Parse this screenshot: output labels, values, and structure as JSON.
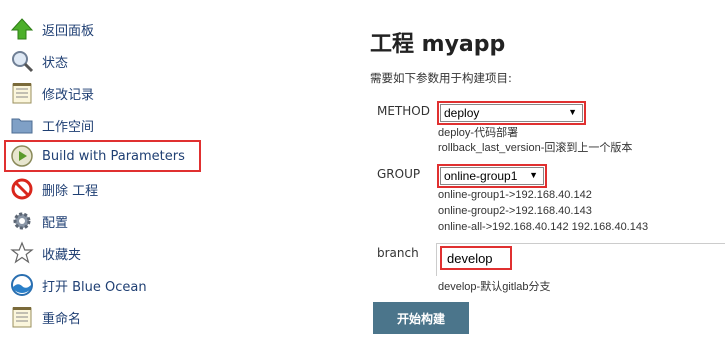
{
  "sidebar": {
    "items": [
      {
        "label": "返回面板",
        "icon": "up-arrow-icon"
      },
      {
        "label": "状态",
        "icon": "magnifier-icon"
      },
      {
        "label": "修改记录",
        "icon": "notepad-icon"
      },
      {
        "label": "工作空间",
        "icon": "folder-icon"
      },
      {
        "label": "Build with Parameters",
        "icon": "clock-play-icon"
      },
      {
        "label": "删除 工程",
        "icon": "no-entry-icon"
      },
      {
        "label": "配置",
        "icon": "gear-icon"
      },
      {
        "label": "收藏夹",
        "icon": "star-icon"
      },
      {
        "label": "打开 Blue Ocean",
        "icon": "blue-ocean-icon"
      },
      {
        "label": "重命名",
        "icon": "notepad-icon"
      }
    ]
  },
  "main": {
    "title": "工程 myapp",
    "description": "需要如下参数用于构建项目:",
    "params": {
      "method": {
        "label": "METHOD",
        "selected": "deploy",
        "desc": [
          "deploy-代码部署",
          "rollback_last_version-回滚到上一个版本"
        ]
      },
      "group": {
        "label": "GROUP",
        "selected": "online-group1",
        "desc": [
          "online-group1->192.168.40.142",
          "online-group2->192.168.40.143",
          "online-all->192.168.40.142 192.168.40.143"
        ]
      },
      "branch": {
        "label": "branch",
        "value": "develop",
        "desc": "develop-默认gitlab分支"
      }
    },
    "build_button": "开始构建"
  },
  "colors": {
    "highlight": "#e03030",
    "link": "#1f3f73",
    "button": "#4b758b"
  }
}
